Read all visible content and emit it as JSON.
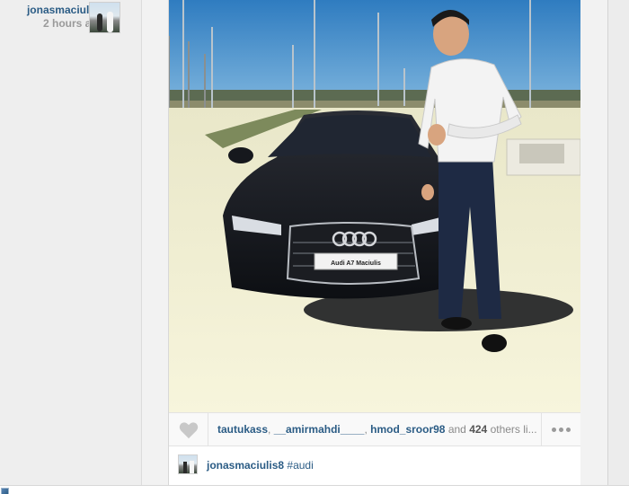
{
  "post": {
    "username": "jonasmaciulis8",
    "time_ago": "2 hours ago",
    "plate_text": "Audi A7 Maciulis",
    "likes": {
      "users": [
        "tautukass",
        "__amirmahdi____",
        "hmod_sroor98"
      ],
      "separator": ", ",
      "and_word": "and",
      "others_count": "424",
      "others_suffix": "others li..."
    },
    "caption": {
      "username": "jonasmaciulis8",
      "hashtag": "#audi"
    }
  },
  "icons": {
    "like": "heart-icon",
    "more": "more-options-icon"
  },
  "colors": {
    "link": "#2b5c85",
    "muted": "#9a9a9a",
    "car": "#15171c",
    "sky": "#3f86c4"
  }
}
